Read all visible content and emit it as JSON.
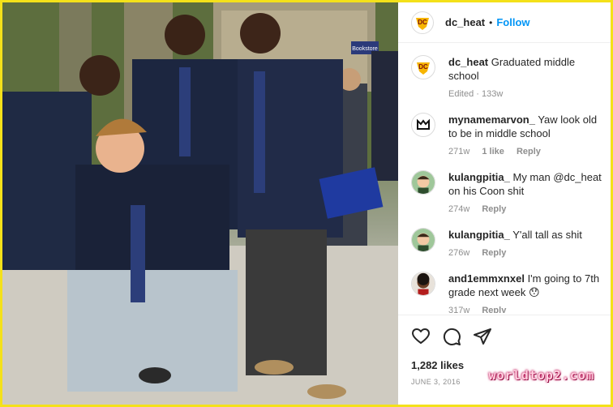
{
  "post": {
    "username": "dc_heat",
    "follow_label": "Follow",
    "separator": "•",
    "likes": "1,282 likes",
    "date": "JUNE 3, 2016"
  },
  "photo": {
    "sign_text": "Bookstore"
  },
  "caption": {
    "username": "dc_heat",
    "text": "Graduated middle school",
    "meta": "Edited · 133w"
  },
  "comments": [
    {
      "username": "mynamemarvon_",
      "text": "Yaw look old to be in middle school",
      "age": "271w",
      "likes": "1 like",
      "reply": "Reply"
    },
    {
      "username": "kulangpitia_",
      "text": "My man @dc_heat on his Coon shit",
      "age": "274w",
      "reply": "Reply"
    },
    {
      "username": "kulangpitia_",
      "text": "Y'all tall as shit",
      "age": "276w",
      "reply": "Reply"
    },
    {
      "username": "and1emmxnxel",
      "text": "I'm going to 7th grade next week 😯",
      "age": "317w",
      "reply": "Reply"
    }
  ],
  "icons": [
    "heart-icon",
    "comment-icon",
    "share-icon"
  ],
  "watermark": "worldtop2.com",
  "colors": {
    "link": "#0095f6",
    "border": "#f4e11a",
    "muted": "#8e8e8e"
  }
}
